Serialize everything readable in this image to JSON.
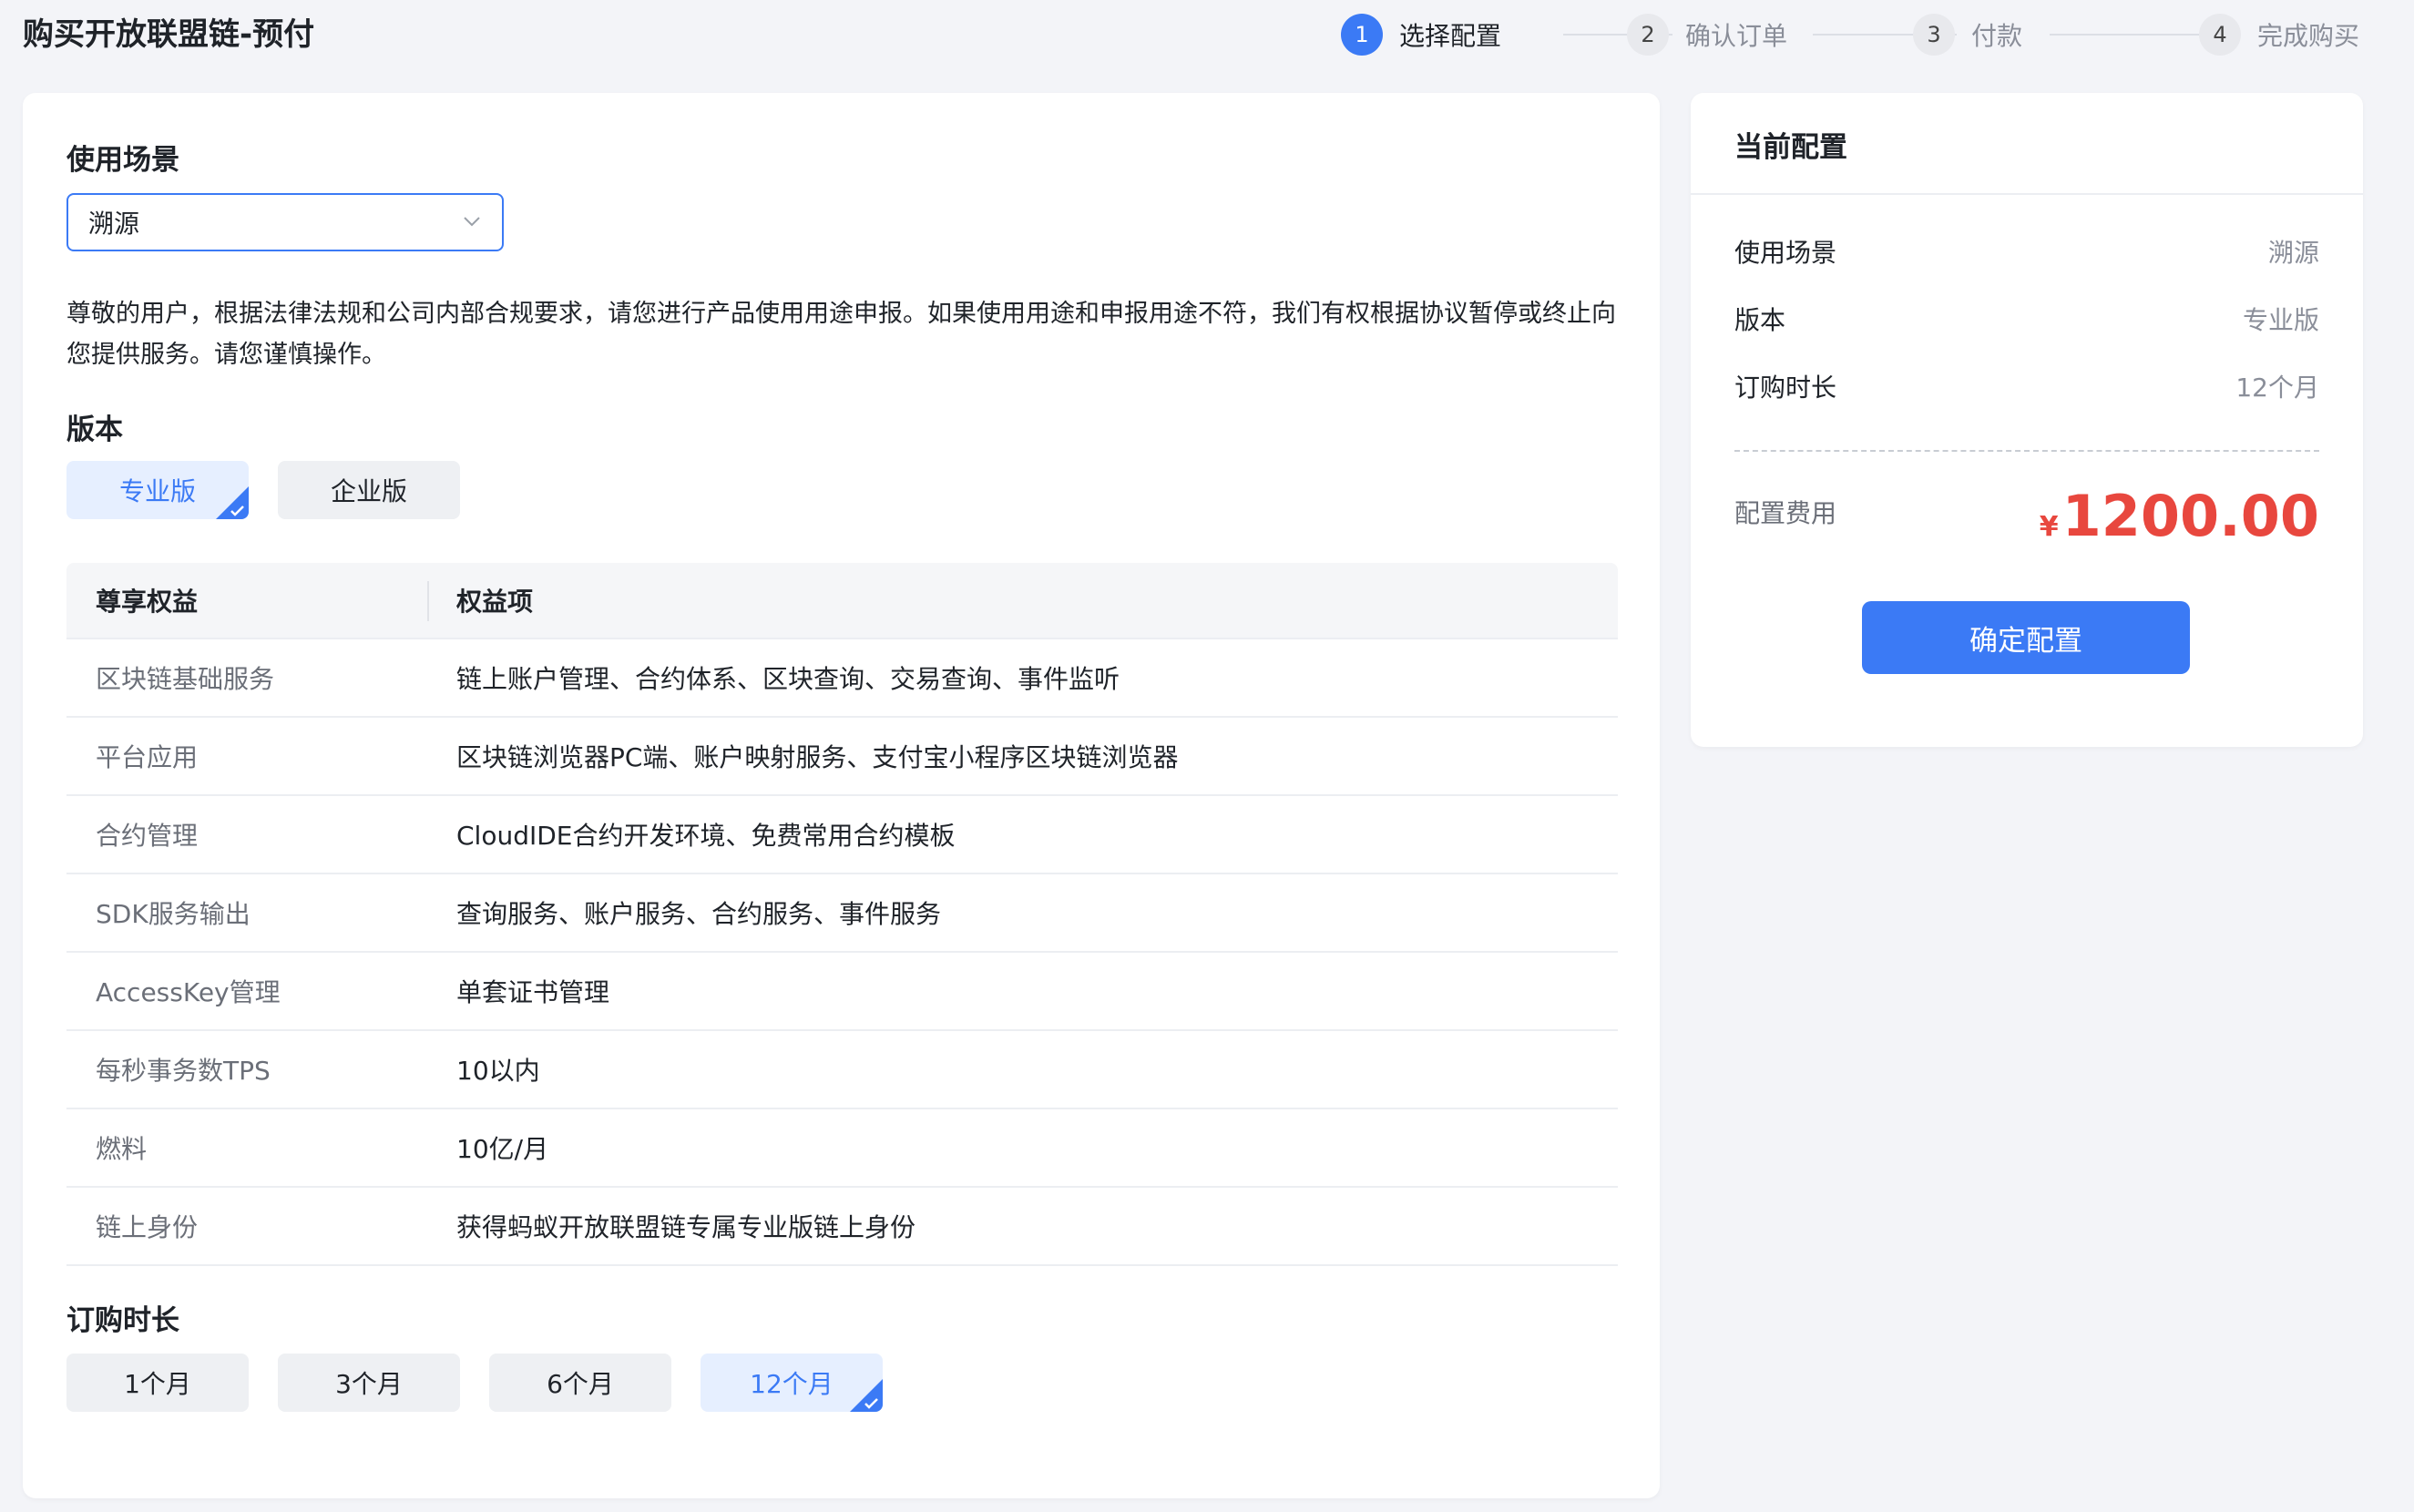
{
  "header": {
    "title": "购买开放联盟链-预付"
  },
  "steps": [
    {
      "num": "1",
      "label": "选择配置",
      "active": true
    },
    {
      "num": "2",
      "label": "确认订单",
      "active": false
    },
    {
      "num": "3",
      "label": "付款",
      "active": false
    },
    {
      "num": "4",
      "label": "完成购买",
      "active": false
    }
  ],
  "scenario": {
    "label": "使用场景",
    "selected": "溯源",
    "icon": "chevron-down-icon"
  },
  "notice": "尊敬的用户，根据法律法规和公司内部合规要求，请您进行产品使用用途申报。如果使用用途和申报用途不符，我们有权根据协议暂停或终止向您提供服务。请您谨慎操作。",
  "edition": {
    "label": "版本",
    "options": [
      "专业版",
      "企业版"
    ],
    "selected_index": 0
  },
  "benefits_table": {
    "headers": [
      "尊享权益",
      "权益项"
    ],
    "rows": [
      [
        "区块链基础服务",
        "链上账户管理、合约体系、区块查询、交易查询、事件监听"
      ],
      [
        "平台应用",
        "区块链浏览器PC端、账户映射服务、支付宝小程序区块链浏览器"
      ],
      [
        "合约管理",
        "CloudIDE合约开发环境、免费常用合约模板"
      ],
      [
        "SDK服务输出",
        "查询服务、账户服务、合约服务、事件服务"
      ],
      [
        "AccessKey管理",
        "单套证书管理"
      ],
      [
        "每秒事务数TPS",
        "10以内"
      ],
      [
        "燃料",
        "10亿/月"
      ],
      [
        "链上身份",
        "获得蚂蚁开放联盟链专属专业版链上身份"
      ]
    ]
  },
  "duration": {
    "label": "订购时长",
    "options": [
      "1个月",
      "3个月",
      "6个月",
      "12个月"
    ],
    "selected_index": 3
  },
  "summary": {
    "title": "当前配置",
    "rows": [
      {
        "key": "使用场景",
        "value": "溯源"
      },
      {
        "key": "版本",
        "value": "专业版"
      },
      {
        "key": "订购时长",
        "value": "12个月"
      }
    ],
    "fee_label": "配置费用",
    "currency": "¥",
    "fee": "1200.00",
    "confirm_label": "确定配置"
  },
  "colors": {
    "accent": "#3b7af5",
    "price": "#e8473e",
    "background": "#f3f4f8"
  }
}
